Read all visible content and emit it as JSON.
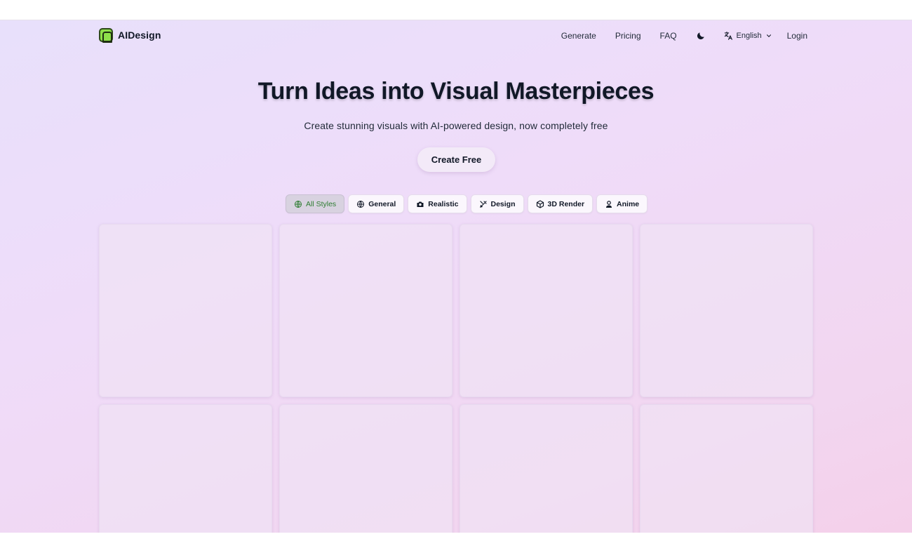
{
  "brand": {
    "name": "AIDesign"
  },
  "nav": {
    "generate": "Generate",
    "pricing": "Pricing",
    "faq": "FAQ",
    "language": "English",
    "login": "Login"
  },
  "hero": {
    "title": "Turn Ideas into Visual Masterpieces",
    "subtitle": "Create stunning visuals with AI-powered design, now completely free",
    "cta": "Create Free"
  },
  "filters": [
    {
      "label": "All Styles",
      "icon": "globe-icon",
      "active": true
    },
    {
      "label": "General",
      "icon": "globe-icon",
      "active": false
    },
    {
      "label": "Realistic",
      "icon": "camera-icon",
      "active": false
    },
    {
      "label": "Design",
      "icon": "design-tools-icon",
      "active": false
    },
    {
      "label": "3D Render",
      "icon": "cube-icon",
      "active": false
    },
    {
      "label": "Anime",
      "icon": "person-icon",
      "active": false
    }
  ],
  "colors": {
    "accent_green": "#2e7d32",
    "logo_green": "#8ee04a",
    "text": "#111827"
  }
}
